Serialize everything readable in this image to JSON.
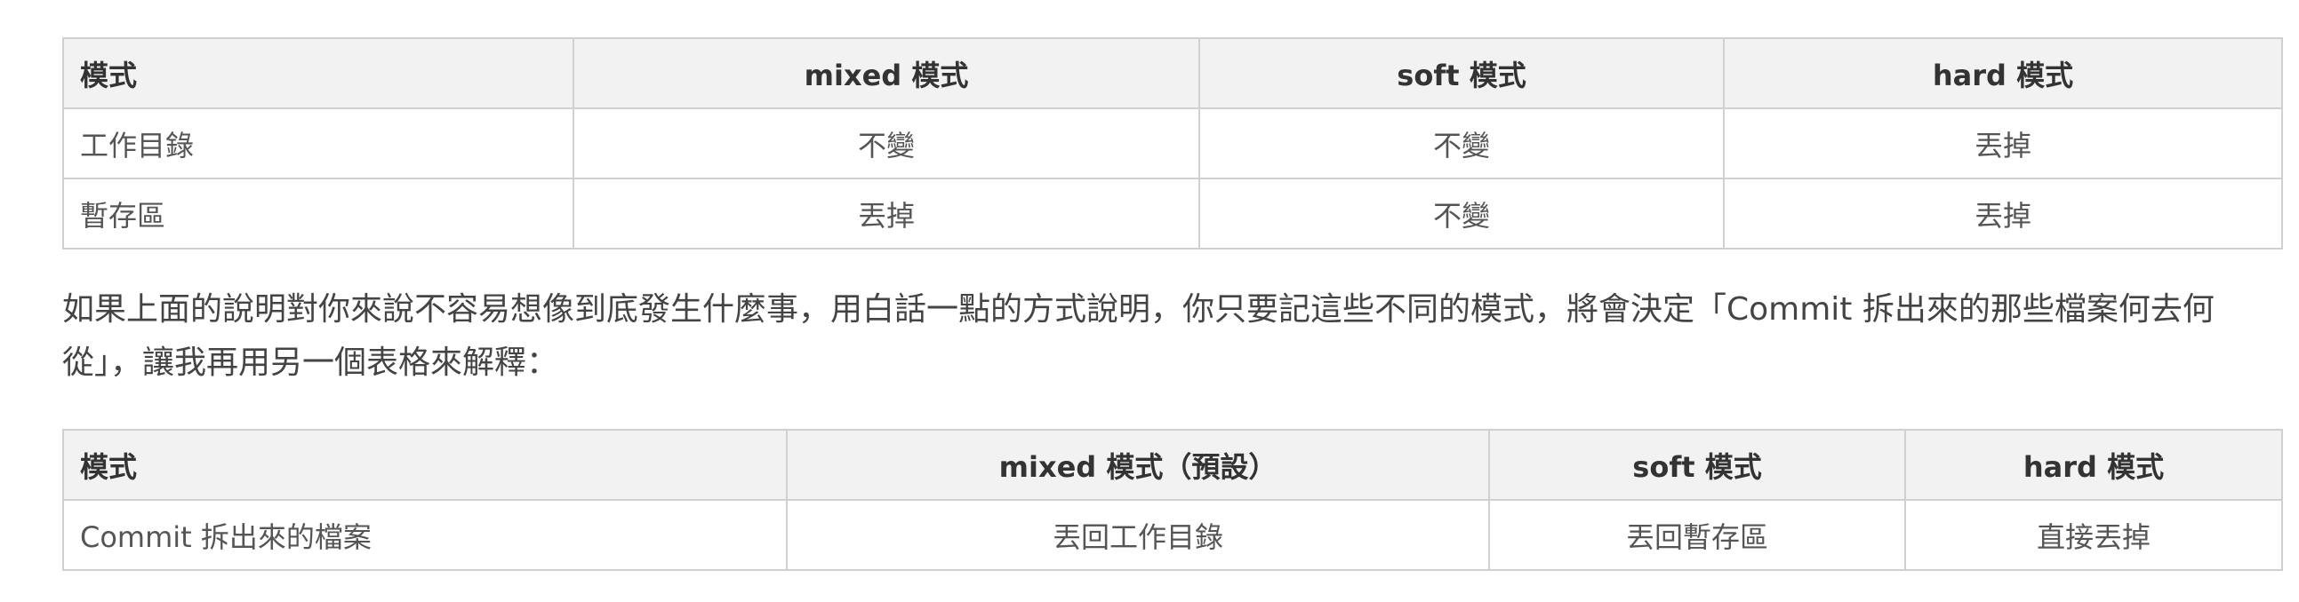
{
  "table1": {
    "headers": [
      "模式",
      "mixed 模式",
      "soft 模式",
      "hard 模式"
    ],
    "rows": [
      [
        "工作目錄",
        "不變",
        "不變",
        "丟掉"
      ],
      [
        "暫存區",
        "丟掉",
        "不變",
        "丟掉"
      ]
    ]
  },
  "paragraph": "如果上面的說明對你來說不容易想像到底發生什麼事，用白話一點的方式說明，你只要記這些不同的模式，將會決定「Commit 拆出來的那些檔案何去何從」，讓我再用另一個表格來解釋：",
  "table2": {
    "headers": [
      "模式",
      "mixed 模式（預設）",
      "soft 模式",
      "hard 模式"
    ],
    "rows": [
      [
        "Commit 拆出來的檔案",
        "丟回工作目錄",
        "丟回暫存區",
        "直接丟掉"
      ]
    ]
  }
}
